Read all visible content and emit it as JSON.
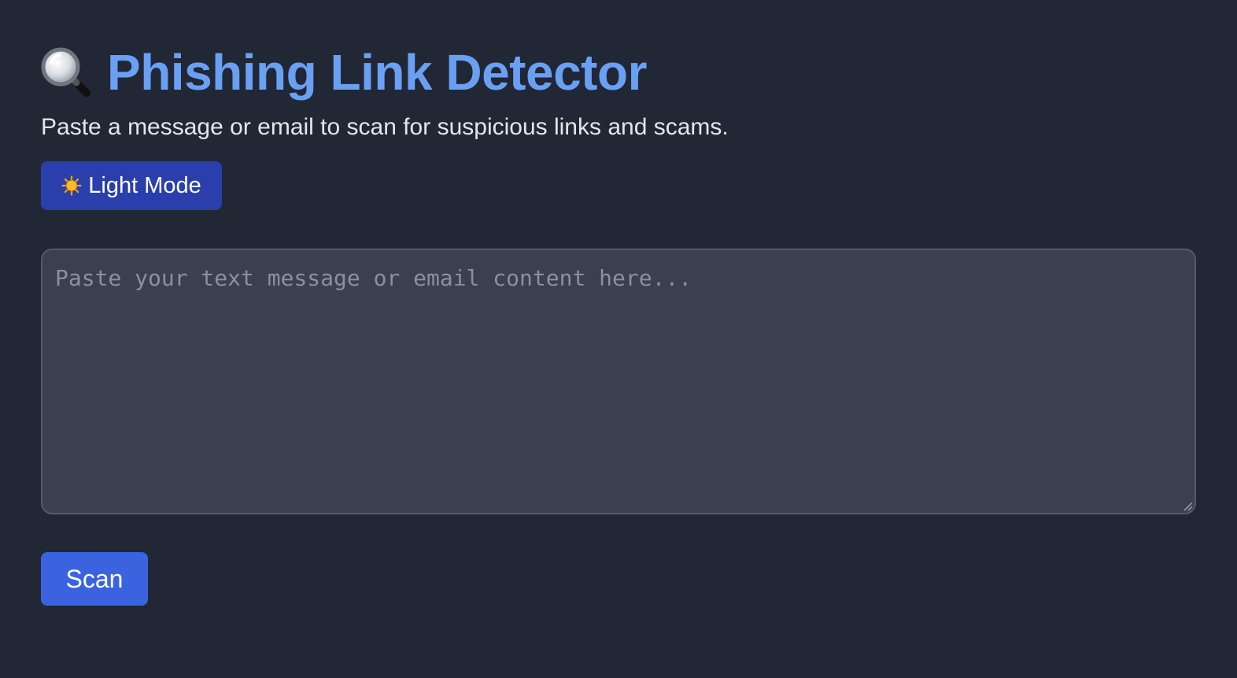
{
  "header": {
    "icon": "magnifying-glass-icon",
    "title": "Phishing Link Detector",
    "subtitle": "Paste a message or email to scan for suspicious links and scams."
  },
  "theme_toggle": {
    "icon": "sun-icon",
    "label": "Light Mode"
  },
  "message_input": {
    "value": "",
    "placeholder": "Paste your text message or email content here..."
  },
  "scan_button": {
    "label": "Scan"
  },
  "colors": {
    "background": "#212735",
    "title": "#6aa0f3",
    "toggle_button": "#2a3fac",
    "scan_button": "#3b63e0",
    "input_background": "#3a404f"
  }
}
